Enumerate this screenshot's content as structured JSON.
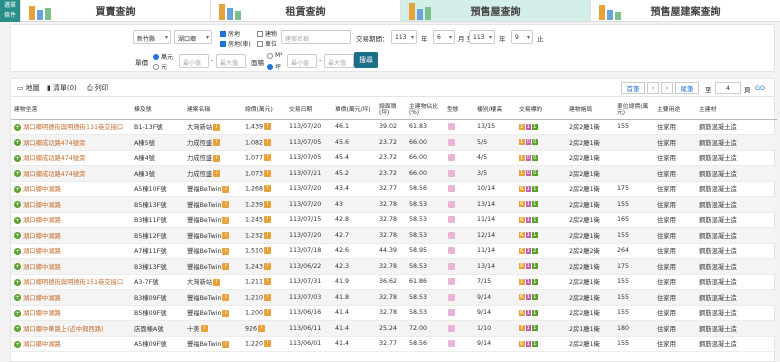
{
  "menu": {
    "label": "選單\n條件"
  },
  "tabs": [
    {
      "label": "買賣查詢",
      "active": false
    },
    {
      "label": "租賃查詢",
      "active": false
    },
    {
      "label": "預售屋查詢",
      "active": true
    },
    {
      "label": "預售屋建案查詢",
      "active": false
    }
  ],
  "filters": {
    "city": "新竹縣",
    "district": "湖口鄉",
    "types": [
      {
        "label": "房地",
        "checked": true
      },
      {
        "label": "建物",
        "checked": false
      },
      {
        "label": "房地(車)",
        "checked": true
      },
      {
        "label": "車位",
        "checked": false
      }
    ],
    "name_placeholder": "建案名稱",
    "date_label": "交易期間：",
    "year_from": "113",
    "year_from_unit": "年",
    "month_from": "6",
    "month_from_unit": "月 至",
    "year_to": "113",
    "year_to_unit": "年",
    "month_to": "9",
    "month_to_unit": "止",
    "price_label": "單價",
    "price_units": [
      {
        "label": "萬元",
        "checked": true
      },
      {
        "label": "元",
        "checked": false
      }
    ],
    "price_min_placeholder": "最小值",
    "price_max_placeholder": "最大值",
    "area_label": "面積",
    "area_units": [
      {
        "label": "M²",
        "checked": false
      },
      {
        "label": "坪",
        "checked": true
      }
    ],
    "area_min_placeholder": "最小值",
    "area_max_placeholder": "最大值",
    "dash": "-",
    "search_label": "搜尋"
  },
  "toolbar": {
    "map": "地圖",
    "list": "清單(0)",
    "print": "列印",
    "first": "首筆",
    "prev": "‹",
    "next": "›",
    "last": "尾筆",
    "page_prefix": "至",
    "page_value": "4",
    "page_suffix": "頁",
    "go": "GO"
  },
  "headers": [
    "建物坐落",
    "棟及號",
    "建案名稱",
    "總價(萬元)",
    "交易日期",
    "單價(萬元/坪)",
    "總面積(坪)",
    "主建物佔比(%)",
    "型態",
    "樓別/樓高",
    "交易標的",
    "建物格局",
    "車位總價(萬元)",
    "主要用途",
    "主建材"
  ],
  "rows": [
    {
      "addr": "湖口鄉明德街與明德街131巷交接口",
      "unit": "B1-13F號",
      "proj": "大灣新站",
      "price": "1,439",
      "date": "113/07/20",
      "unit_price": "46.1",
      "area": "39.02",
      "ratio": "61.83",
      "floor": "13/15",
      "tags": [
        "1",
        "1",
        "1"
      ],
      "layout": "2房2廳1衛",
      "park": "155",
      "use": "住家用",
      "mat": "鋼筋混凝土造"
    },
    {
      "addr": "湖口鄉成功路474號旁",
      "unit": "A棟5號",
      "proj": "力成恆盛",
      "price": "1,082",
      "date": "113/07/05",
      "unit_price": "45.6",
      "area": "23.72",
      "ratio": "66.00",
      "floor": "5/5",
      "tags": [
        "1",
        "0",
        "0"
      ],
      "layout": "2房2廳1衛",
      "park": "",
      "use": "住家用",
      "mat": "鋼筋混凝土造"
    },
    {
      "addr": "湖口鄉成功路474號旁",
      "unit": "A棟4號",
      "proj": "力成恆盛",
      "price": "1,077",
      "date": "113/07/05",
      "unit_price": "45.4",
      "area": "23.72",
      "ratio": "66.00",
      "floor": "4/5",
      "tags": [
        "1",
        "0",
        "0"
      ],
      "layout": "2房2廳1衛",
      "park": "",
      "use": "住家用",
      "mat": "鋼筋混凝土造"
    },
    {
      "addr": "湖口鄉成功路474號旁",
      "unit": "A棟3號",
      "proj": "力成恆盛",
      "price": "1,073",
      "date": "113/07/21",
      "unit_price": "45.2",
      "area": "23.72",
      "ratio": "66.00",
      "floor": "3/5",
      "tags": [
        "1",
        "0",
        "0"
      ],
      "layout": "2房2廳1衛",
      "park": "",
      "use": "住家用",
      "mat": "鋼筋混凝土造"
    },
    {
      "addr": "湖口鄉中湖路",
      "unit": "A5棟10F號",
      "proj": "豐福BeTwin",
      "price": "1,268",
      "date": "113/07/20",
      "unit_price": "43.4",
      "area": "32.77",
      "ratio": "58.56",
      "floor": "10/14",
      "tags": [
        "6",
        "1",
        "1"
      ],
      "layout": "2房2廳1衛",
      "park": "175",
      "use": "住家用",
      "mat": "鋼筋混凝土造"
    },
    {
      "addr": "湖口鄉中湖路",
      "unit": "B5棟13F號",
      "proj": "豐福BeTwin",
      "price": "1,239",
      "date": "113/07/20",
      "unit_price": "43",
      "area": "32.78",
      "ratio": "58.53",
      "floor": "13/14",
      "tags": [
        "6",
        "1",
        "1"
      ],
      "layout": "2房2廳1衛",
      "park": "155",
      "use": "住家用",
      "mat": "鋼筋混凝土造"
    },
    {
      "addr": "湖口鄉中湖路",
      "unit": "B3棟11F號",
      "proj": "豐福BeTwin",
      "price": "1,245",
      "date": "113/07/15",
      "unit_price": "42.8",
      "area": "32.78",
      "ratio": "58.53",
      "floor": "11/14",
      "tags": [
        "6",
        "1",
        "1"
      ],
      "layout": "2房2廳1衛",
      "park": "165",
      "use": "住家用",
      "mat": "鋼筋混凝土造"
    },
    {
      "addr": "湖口鄉中湖路",
      "unit": "B5棟12F號",
      "proj": "豐福BeTwin",
      "price": "1,232",
      "date": "113/07/20",
      "unit_price": "42.7",
      "area": "32.78",
      "ratio": "58.53",
      "floor": "12/14",
      "tags": [
        "6",
        "1",
        "1"
      ],
      "layout": "2房2廳1衛",
      "park": "155",
      "use": "住家用",
      "mat": "鋼筋混凝土造"
    },
    {
      "addr": "湖口鄉中湖路",
      "unit": "A7棟11F號",
      "proj": "豐福BeTwin",
      "price": "1,510",
      "date": "113/07/18",
      "unit_price": "42.6",
      "area": "44.39",
      "ratio": "58.95",
      "floor": "11/14",
      "tags": [
        "6",
        "1",
        "2"
      ],
      "layout": "2房2廳2衛",
      "park": "264",
      "use": "住家用",
      "mat": "鋼筋混凝土造"
    },
    {
      "addr": "湖口鄉中湖路",
      "unit": "B3棟13F號",
      "proj": "豐福BeTwin",
      "price": "1,243",
      "date": "113/06/22",
      "unit_price": "42.3",
      "area": "32.78",
      "ratio": "58.53",
      "floor": "13/14",
      "tags": [
        "6",
        "1",
        "1"
      ],
      "layout": "2房2廳1衛",
      "park": "175",
      "use": "住家用",
      "mat": "鋼筋混凝土造"
    },
    {
      "addr": "湖口鄉明德街與明德街151巷交接口",
      "unit": "A3-7F號",
      "proj": "大灣新站",
      "price": "1,211",
      "date": "113/07/31",
      "unit_price": "41.9",
      "area": "36.62",
      "ratio": "61.86",
      "floor": "7/15",
      "tags": [
        "1",
        "1",
        "1"
      ],
      "layout": "2房2廳1衛",
      "park": "155",
      "use": "住家用",
      "mat": "鋼筋混凝土造"
    },
    {
      "addr": "湖口鄉中湖路",
      "unit": "B3棟09F號",
      "proj": "豐福BeTwin",
      "price": "1,210",
      "date": "113/07/03",
      "unit_price": "41.8",
      "area": "32.78",
      "ratio": "58.53",
      "floor": "9/14",
      "tags": [
        "6",
        "1",
        "1"
      ],
      "layout": "2房2廳1衛",
      "park": "155",
      "use": "住家用",
      "mat": "鋼筋混凝土造"
    },
    {
      "addr": "湖口鄉中湖路",
      "unit": "B5棟09F號",
      "proj": "豐福BeTwin",
      "price": "1,200",
      "date": "113/06/16",
      "unit_price": "41.4",
      "area": "32.78",
      "ratio": "58.53",
      "floor": "9/14",
      "tags": [
        "6",
        "1",
        "1"
      ],
      "layout": "2房2廳1衛",
      "park": "155",
      "use": "住家用",
      "mat": "鋼筋混凝土造"
    },
    {
      "addr": "湖口鄉中華路上(近中興西路)",
      "unit": "店面棟A號",
      "proj": "十美",
      "price": "926",
      "date": "113/06/11",
      "unit_price": "41.4",
      "area": "25.24",
      "ratio": "72.00",
      "floor": "1/10",
      "tags": [
        "7",
        "1",
        "1"
      ],
      "layout": "2房1廳1衛",
      "park": "180",
      "use": "住家用",
      "mat": "鋼筋混凝土造"
    },
    {
      "addr": "湖口鄉中湖路",
      "unit": "A5棟09F號",
      "proj": "豐福BeTwin",
      "price": "1,220",
      "date": "113/06/01",
      "unit_price": "41.4",
      "area": "32.77",
      "ratio": "58.56",
      "floor": "9/14",
      "tags": [
        "6",
        "1",
        "1"
      ],
      "layout": "2房2廳1衛",
      "park": "155",
      "use": "住家用",
      "mat": "鋼筋混凝土造"
    }
  ]
}
